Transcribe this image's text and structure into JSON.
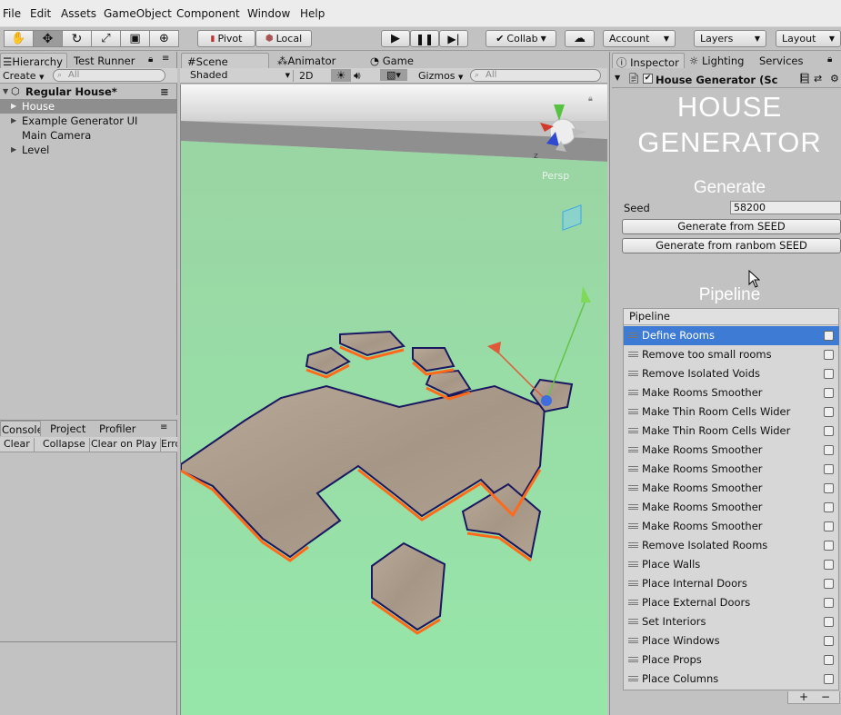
{
  "menu": {
    "items": [
      "File",
      "Edit",
      "Assets",
      "GameObject",
      "Component",
      "Window",
      "Help"
    ]
  },
  "toolbar": {
    "pivot": "Pivot",
    "local": "Local",
    "collab": "Collab",
    "account": "Account",
    "layers": "Layers",
    "layout": "Layout"
  },
  "hierarchy": {
    "tab": "Hierarchy",
    "tab2": "Test Runner",
    "create": "Create",
    "search_placeholder": "All",
    "scene": "Regular House*",
    "items": [
      "House",
      "Example Generator UI",
      "Main Camera",
      "Level"
    ]
  },
  "scene": {
    "tab": "Scene",
    "tab2": "Animator",
    "tab3": "Game",
    "shading": "Shaded",
    "mode2d": "2D",
    "gizmos": "Gizmos",
    "search_placeholder": "All",
    "gizmo_label": "Persp",
    "axis_z": "z"
  },
  "console": {
    "tab": "Console",
    "tab2": "Project",
    "tab3": "Profiler",
    "clear": "Clear",
    "collapse": "Collapse",
    "clear_on_play": "Clear on Play",
    "error": "Error"
  },
  "inspector": {
    "tab": "Inspector",
    "tab2": "Lighting",
    "tab3": "Services",
    "component": "House Generator (Sc",
    "title1": "HOUSE",
    "title2": "GENERATOR",
    "generate_header": "Generate",
    "seed_label": "Seed",
    "seed_value": "58200",
    "btn_seed": "Generate from SEED",
    "btn_random": "Generate from ranbom SEED",
    "pipeline_header": "Pipeline",
    "pipeline_list_header": "Pipeline",
    "pipeline": [
      "Define Rooms",
      "Remove too small rooms",
      "Remove Isolated Voids",
      "Make Rooms Smoother",
      "Make Thin Room Cells Wider",
      "Make Thin Room Cells Wider",
      "Make Rooms Smoother",
      "Make Rooms Smoother",
      "Make Rooms Smoother",
      "Make Rooms Smoother",
      "Make Rooms Smoother",
      "Remove Isolated Rooms",
      "Place Walls",
      "Place Internal Doors",
      "Place External Doors",
      "Set Interiors",
      "Place Windows",
      "Place Props",
      "Place Columns"
    ],
    "add": "+",
    "remove": "−"
  }
}
